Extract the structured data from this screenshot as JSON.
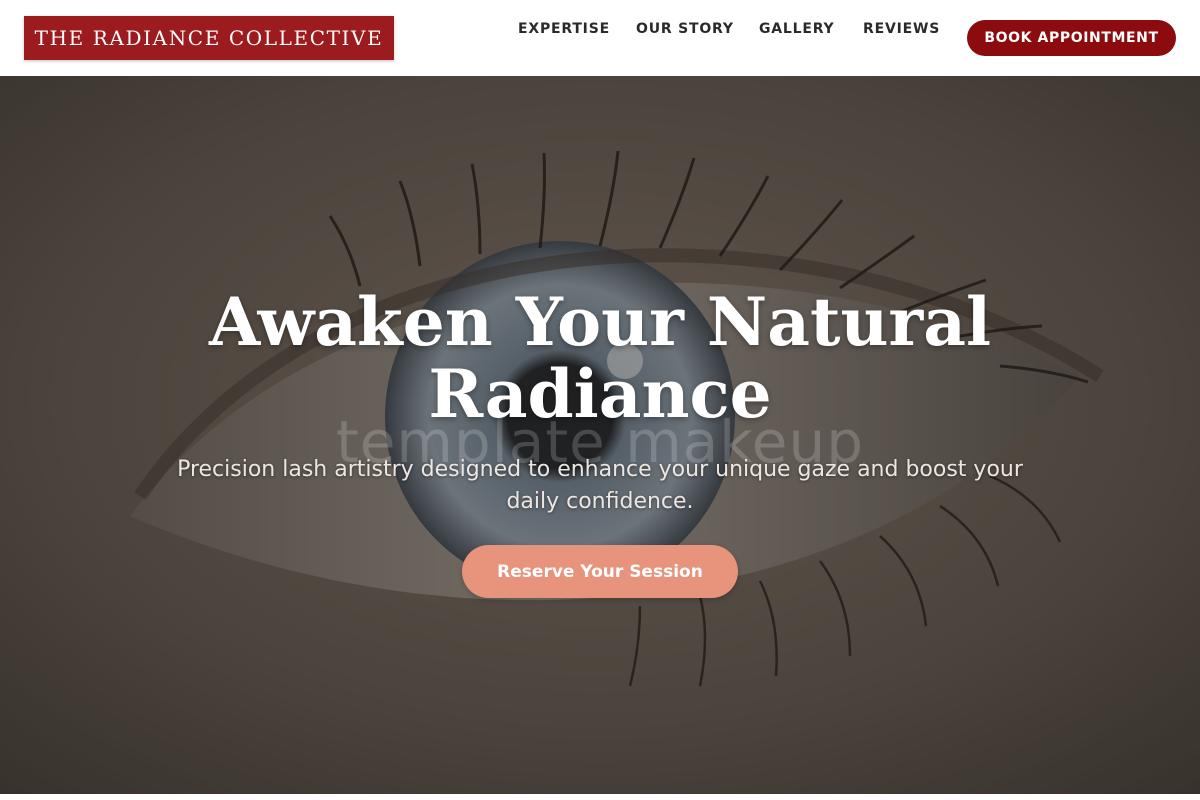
{
  "header": {
    "logo_text": "THE RADIANCE COLLECTIVE",
    "nav": [
      "EXPERTISE",
      "OUR STORY",
      "GALLERY",
      "REVIEWS"
    ],
    "book_button": "BOOK APPOINTMENT"
  },
  "hero": {
    "title": "Awaken Your Natural Radiance",
    "subtitle": "Precision lash artistry designed to enhance your unique gaze and boost your daily confidence.",
    "cta": "Reserve Your Session",
    "watermark": "template makeup",
    "background_image": "close-up-eye-photo"
  },
  "colors": {
    "brand_red": "#9b1b1f",
    "book_button": "#8b0b0f",
    "cta": "#e8937b",
    "nav_text": "#2a2a2a"
  }
}
